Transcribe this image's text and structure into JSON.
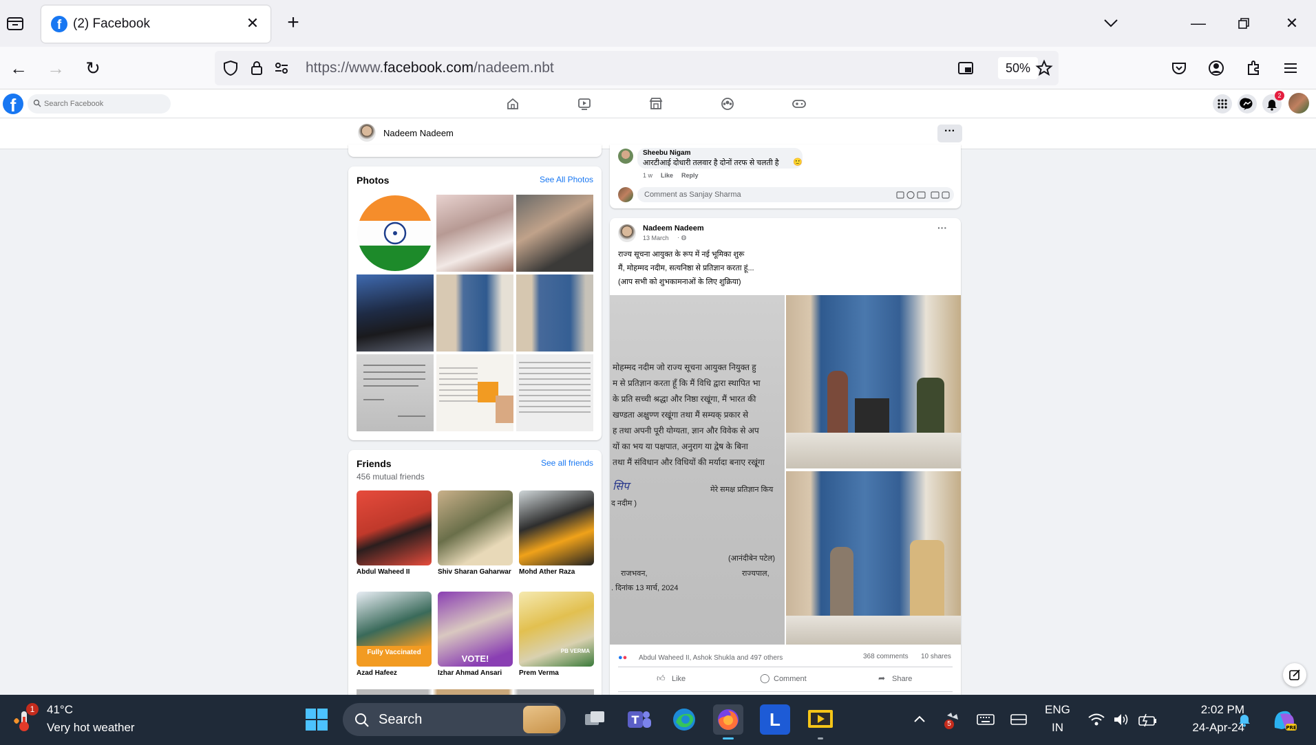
{
  "browser": {
    "tab_title": "(2) Facebook",
    "url_prefix": "https://www.",
    "url_domain": "facebook.com",
    "url_path": "/nadeem.nbt",
    "zoom": "50%"
  },
  "fb": {
    "search_placeholder": "Search Facebook",
    "notification_count": "2"
  },
  "profile_bar": {
    "name": "Nadeem Nadeem",
    "more": "···"
  },
  "photos": {
    "title": "Photos",
    "see_all": "See All Photos"
  },
  "friends": {
    "title": "Friends",
    "see_all": "See all friends",
    "mutual": "456 mutual friends",
    "items": [
      {
        "name": "Abdul Waheed II"
      },
      {
        "name": "Shiv Sharan Gaharwar"
      },
      {
        "name": "Mohd Ather Raza"
      },
      {
        "name": "Azad Hafeez",
        "overlay": "Fully Vaccinated"
      },
      {
        "name": "Izhar Ahmad Ansari",
        "overlay": "VOTE!"
      },
      {
        "name": "Prem Verma",
        "overlay": "PB VERMA"
      }
    ]
  },
  "comment": {
    "author": "Sheebu Nigam",
    "text": "आरटीआई दोधारी तलवार है दोनों तरफ से चलती है",
    "time": "1 w",
    "like": "Like",
    "reply": "Reply",
    "composer_placeholder": "Comment as Sanjay Sharma"
  },
  "post": {
    "author": "Nadeem Nadeem",
    "date": "13 March",
    "lines": [
      "राज्य सूचना आयुक्त के रूप में नई भूमिका शुरू",
      "मैं, मोहम्मद नदीम, सत्यनिष्ठा से प्रतिज्ञान करता हूं...",
      "(आप सभी को शुभकामनाओं के लिए शुक्रिया)"
    ],
    "doc_lines": [
      "मोहम्मद नदीम जो राज्य सूचना आयुक्त नियुक्त हु",
      "म से प्रतिज्ञान करता हूँ कि मैं विधि द्वारा स्थापित भा",
      "के प्रति सच्ची श्रद्धा और निष्ठा रखूंगा, मैं भारत की",
      "खण्डता अक्षुण्ण रखूंगा तथा मैं सम्यक् प्रकार से",
      "ह तथा अपनी पूरी योग्यता, ज्ञान और विवेक से अप",
      "यों का भय या पक्षपात, अनुराग या द्वेष के बिना",
      "तथा मैं संविधान और विधियों की मर्यादा बनाए रखूंगा"
    ],
    "doc_sign_1": "मेरे समक्ष प्रतिज्ञान किय",
    "doc_name": "द नदीम )",
    "doc_sign_name": "(आनंदीबेन पटेल)",
    "doc_place": "राजभवन,",
    "doc_title": "राज्यपाल,",
    "doc_date": ". दिनांक 13 मार्च, 2024",
    "reactions": "Abdul Waheed II, Ashok Shukla and 497 others",
    "comments": "368 comments",
    "shares": "10 shares",
    "like": "Like",
    "comment": "Comment",
    "share": "Share",
    "more": "···"
  },
  "taskbar": {
    "weather_badge": "1",
    "temp": "41°C",
    "weather": "Very hot weather",
    "search": "Search",
    "lang_1": "ENG",
    "lang_2": "IN",
    "time": "2:02 PM",
    "date": "24-Apr-24",
    "tray_badge": "5"
  }
}
